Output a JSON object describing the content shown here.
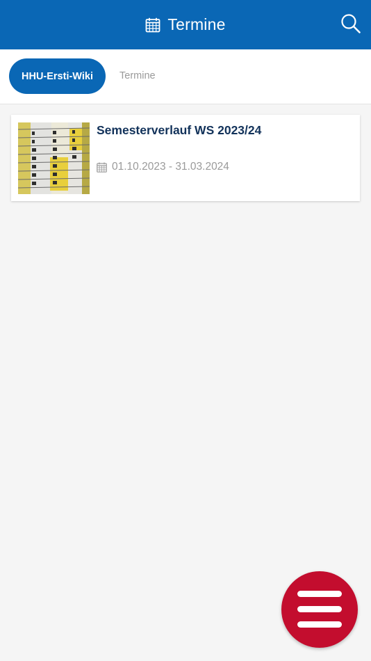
{
  "header": {
    "title": "Termine",
    "title_icon": "calendar-icon",
    "search_icon": "search-icon",
    "background_color": "#0a67b5"
  },
  "breadcrumb": {
    "parent_label": "HHU-Ersti-Wiki",
    "current_label": "Termine"
  },
  "events": [
    {
      "title": "Semesterverlauf WS 2023/24",
      "date_range": "01.10.2023 - 31.03.2024",
      "date_icon": "calendar-icon",
      "thumbnail": "wall-calendar-photo"
    }
  ],
  "fab": {
    "icon": "menu-icon",
    "color": "#c30d2e"
  }
}
